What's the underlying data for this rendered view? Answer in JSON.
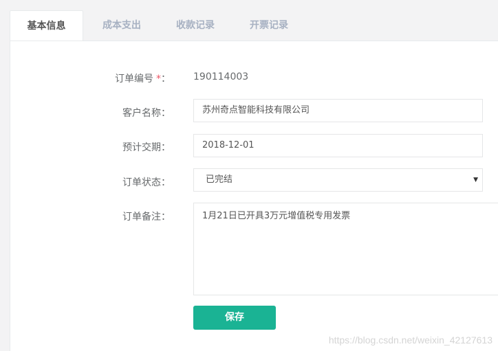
{
  "tabs": [
    {
      "label": "基本信息",
      "active": true
    },
    {
      "label": "成本支出",
      "active": false
    },
    {
      "label": "收款记录",
      "active": false
    },
    {
      "label": "开票记录",
      "active": false
    }
  ],
  "form": {
    "order_no": {
      "label": "订单编号",
      "required_mark": "*",
      "colon": "：",
      "value": "190114003"
    },
    "customer": {
      "label": "客户名称：",
      "value": "苏州奇点智能科技有限公司"
    },
    "delivery": {
      "label": "预计交期：",
      "value": "2018-12-01"
    },
    "status": {
      "label": "订单状态：",
      "value": "已完结",
      "arrow": "▼"
    },
    "remark": {
      "label": "订单备注：",
      "value": "1月21日已开具3万元增值税专用发票"
    },
    "save_label": "保存"
  },
  "watermark": "https://blog.csdn.net/weixin_42127613",
  "colors": {
    "accent": "#1ab394",
    "required": "#ed5565",
    "tab_inactive": "#a7b1c2"
  }
}
